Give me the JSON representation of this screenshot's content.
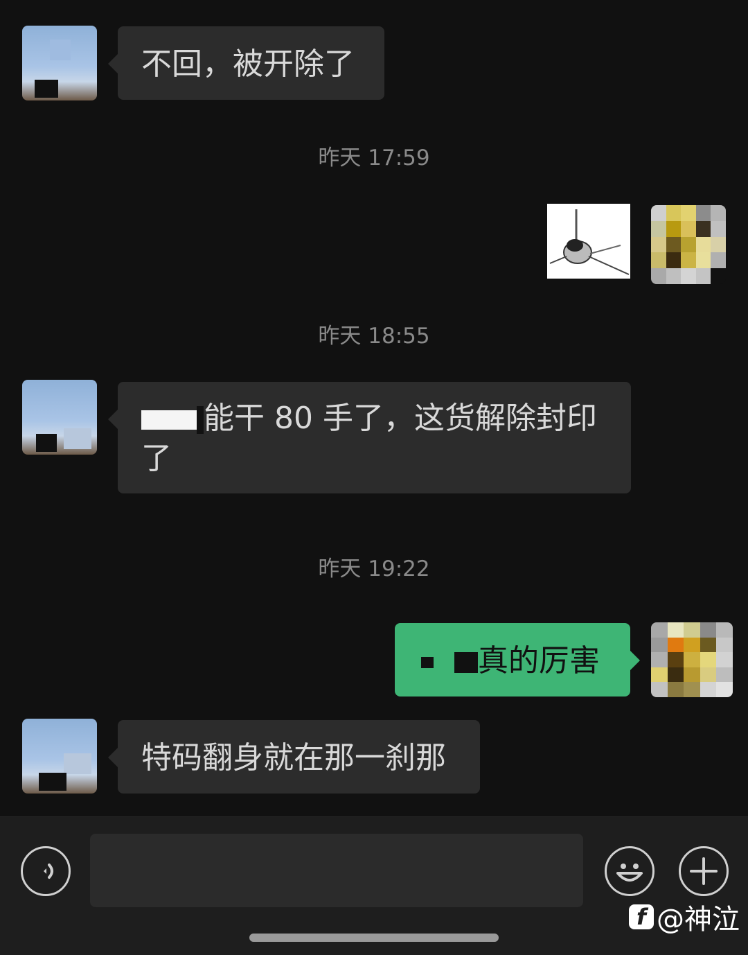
{
  "messages": [
    {
      "side": "left",
      "text": "不回，被开除了"
    },
    {
      "type": "timestamp",
      "text": "昨天 17:59"
    },
    {
      "side": "right",
      "type": "sticker"
    },
    {
      "type": "timestamp",
      "text": "昨天 18:55"
    },
    {
      "side": "left",
      "text_line1": "能干 80 手了，这货解除封印",
      "text_line2": "了"
    },
    {
      "type": "timestamp",
      "text": "昨天 19:22"
    },
    {
      "side": "right",
      "text": "真的厉害"
    },
    {
      "side": "left",
      "text": "特码翻身就在那一刹那"
    }
  ],
  "watermark": {
    "logo": "f",
    "text": "@神泣"
  },
  "colors": {
    "background": "#111111",
    "bubble_left": "#2c2c2c",
    "bubble_right": "#3eb575",
    "timestamp": "#8a8a8a"
  },
  "icons": {
    "voice": "voice-icon",
    "emoji": "emoji-icon",
    "plus": "plus-icon"
  }
}
